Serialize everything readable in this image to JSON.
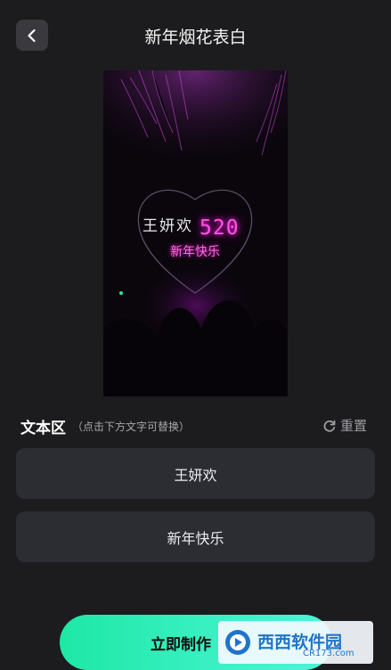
{
  "header": {
    "title": "新年烟花表白",
    "back_icon": "chevron-left-icon"
  },
  "preview": {
    "name_text": "王妍欢",
    "number_text": "520",
    "greeting_text": "新年快乐"
  },
  "text_section": {
    "title": "文本区",
    "hint": "（点击下方文字可替换）",
    "reset_label": "重置",
    "reset_icon": "refresh-icon",
    "fields": [
      "王妍欢",
      "新年快乐"
    ]
  },
  "action": {
    "make_label": "立即制作"
  },
  "watermark": {
    "logo_text": "西西软件园",
    "logo_sub": "CR173.com"
  },
  "colors": {
    "background": "#1c1c1e",
    "field_bg": "#2c2d33",
    "button_gradient_start": "#1ee8a6",
    "button_gradient_end": "#4ef3d8",
    "neon_pink": "#ff52e8"
  }
}
